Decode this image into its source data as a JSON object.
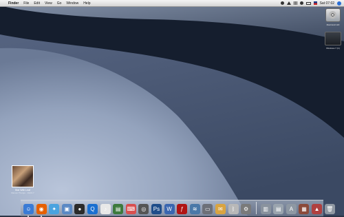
{
  "menubar": {
    "apple_icon": "apple-icon",
    "items": [
      "Finder",
      "File",
      "Edit",
      "View",
      "Go",
      "Window",
      "Help"
    ],
    "clock": "Sat 07:02"
  },
  "desktop": {
    "drives": [
      {
        "label": "Macintosh HD",
        "icon": "hard-drive-icon"
      },
      {
        "label": "Windows 7 (C)",
        "icon": "disk-icon"
      }
    ],
    "file": {
      "name": "Star With Leaf",
      "subtitle": "Ramon Thongs · 1024×7",
      "icon": "image-file-icon"
    }
  },
  "dock": {
    "apps": [
      {
        "name": "finder-icon",
        "glyph": "☺",
        "color": "#3a7bd5",
        "running": true
      },
      {
        "name": "firefox-icon",
        "glyph": "◉",
        "color": "#e66000",
        "running": true
      },
      {
        "name": "safari-icon",
        "glyph": "✦",
        "color": "#4aa3df",
        "running": false
      },
      {
        "name": "preview-icon",
        "glyph": "▣",
        "color": "#5b89c4",
        "running": false
      },
      {
        "name": "adium-icon",
        "glyph": "●",
        "color": "#2b2b2b",
        "running": false
      },
      {
        "name": "quicktime-icon",
        "glyph": "Q",
        "color": "#1a6fd0",
        "running": false
      },
      {
        "name": "itunes-icon",
        "glyph": "♪",
        "color": "#e8e8e8",
        "running": false
      },
      {
        "name": "iphoto-icon",
        "glyph": "▤",
        "color": "#3d7a3d",
        "running": false
      },
      {
        "name": "typewriter-icon",
        "glyph": "⌨",
        "color": "#d85050",
        "running": false
      },
      {
        "name": "camera-icon",
        "glyph": "◎",
        "color": "#555555",
        "running": false
      },
      {
        "name": "photoshop-icon",
        "glyph": "Ps",
        "color": "#1f4d8a",
        "running": false
      },
      {
        "name": "word-icon",
        "glyph": "W",
        "color": "#3a66b0",
        "running": false
      },
      {
        "name": "flash-icon",
        "glyph": "ƒ",
        "color": "#b01414",
        "running": false
      },
      {
        "name": "teleport-icon",
        "glyph": "≋",
        "color": "#4a78a8",
        "running": false
      },
      {
        "name": "drive-icon",
        "glyph": "▭",
        "color": "#6d7078",
        "running": false
      },
      {
        "name": "mail-stamp-icon",
        "glyph": "✉",
        "color": "#d9a441",
        "running": false
      },
      {
        "name": "bluetooth-icon",
        "glyph": "ᛒ",
        "color": "#b8b8b8",
        "running": false
      },
      {
        "name": "system-preferences-icon",
        "glyph": "⚙",
        "color": "#7a7a7a",
        "running": false
      }
    ],
    "stacks": [
      {
        "name": "folder-stack-icon",
        "glyph": "▥",
        "color": "#8a939e"
      },
      {
        "name": "documents-stack-icon",
        "glyph": "▤",
        "color": "#9aa4ae"
      },
      {
        "name": "applications-stack-icon",
        "glyph": "A",
        "color": "#8e98a3"
      },
      {
        "name": "downloads-stack-icon",
        "glyph": "▦",
        "color": "#8b4a3a"
      },
      {
        "name": "utilities-stack-icon",
        "glyph": "▲",
        "color": "#b04040"
      },
      {
        "name": "trash-icon",
        "glyph": "🗑",
        "color": "#9098a2"
      }
    ]
  },
  "colors": {
    "wallpaper_dark": "#141d2c",
    "wallpaper_mid": "#5f6e86",
    "wallpaper_light": "#a7b4cb"
  }
}
